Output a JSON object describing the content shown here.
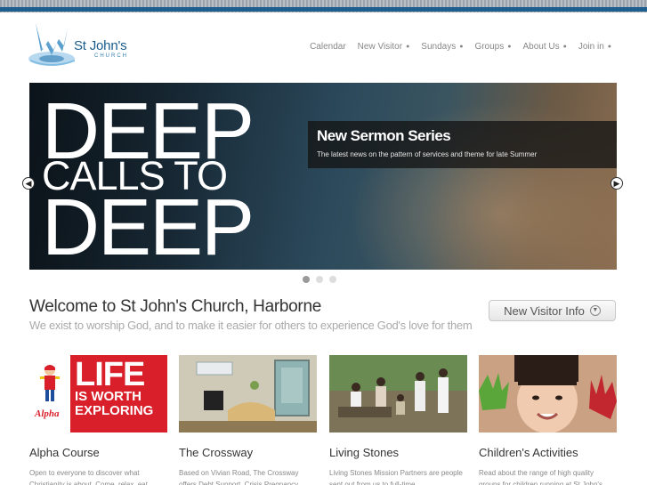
{
  "header": {
    "logo_name": "St John's",
    "logo_sub": "CHURCH"
  },
  "nav": {
    "items": [
      {
        "label": "Calendar",
        "dropdown": false
      },
      {
        "label": "New Visitor",
        "dropdown": true
      },
      {
        "label": "Sundays",
        "dropdown": true
      },
      {
        "label": "Groups",
        "dropdown": true
      },
      {
        "label": "About Us",
        "dropdown": true
      },
      {
        "label": "Join in",
        "dropdown": true
      }
    ]
  },
  "hero": {
    "line1": "DEEP",
    "line2": "CALLS TO",
    "line3": "DEEP",
    "caption_title": "New Sermon Series",
    "caption_text": "The latest news on the pattern of services and theme for late Summer",
    "active_slide": 1,
    "slide_count": 3
  },
  "welcome": {
    "title": "Welcome to St John's Church, Harborne",
    "subtitle": "We exist to worship God, and to make it easier for others to experience God's love for them",
    "button_label": "New Visitor Info"
  },
  "cards": [
    {
      "title": "Alpha Course",
      "text": "Open to everyone to discover what Christianity is about. Come, relax, eat",
      "image_text": {
        "big": "LIFE",
        "small1": "IS WORTH",
        "small2": "EXPLORING",
        "brand": "Alpha"
      }
    },
    {
      "title": "The Crossway",
      "text": "Based on Vivian Road, The Crossway offers Debt Support, Crisis Pregnancy"
    },
    {
      "title": "Living Stones",
      "text": "Living Stones Mission Partners are people sent out from us to full-time"
    },
    {
      "title": "Children's Activities",
      "text": "Read about the range of high quality groups for children running at St John's"
    }
  ],
  "colors": {
    "brand_blue": "#1a5d8c",
    "alpha_red": "#d81f2a"
  }
}
